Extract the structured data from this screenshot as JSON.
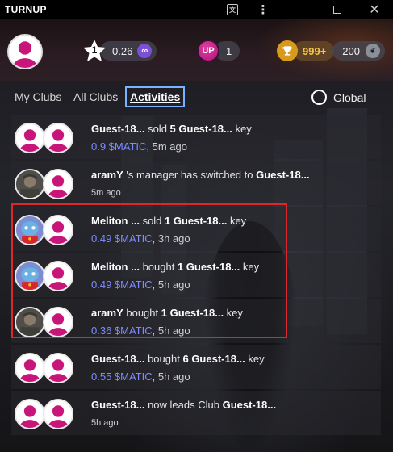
{
  "window": {
    "title": "TURNUP",
    "buttons": {
      "translate": "translate-icon",
      "menu": "more-vertical-icon",
      "minimize": "minimize-icon",
      "maximize": "maximize-icon",
      "close": "close-icon"
    }
  },
  "header": {
    "stars": {
      "badge": "1",
      "value": "0.26",
      "chain_icon": "polygon-icon"
    },
    "ups": {
      "badge": "UP",
      "value": "1"
    },
    "trophy": {
      "value": "999+"
    },
    "points": {
      "value": "200",
      "icon": "leaf-icon"
    }
  },
  "tabs": {
    "items": [
      "My Clubs",
      "All Clubs",
      "Activities"
    ],
    "active": "Activities",
    "global_label": "Global"
  },
  "activities": [
    {
      "actor": "Guest-18...",
      "verb": " sold ",
      "amount": "5",
      "subject": " Guest-18...",
      "suffix": " key",
      "price": "0.9 $MATIC",
      "time": ", 5m ago"
    },
    {
      "actor": "aramY",
      "verb": " 's manager has switched to ",
      "subject": "Guest-18...",
      "time": "5m ago"
    },
    {
      "actor": "Meliton ...",
      "verb": " sold ",
      "amount": "1",
      "subject": " Guest-18...",
      "suffix": " key",
      "price": "0.49 $MATIC",
      "time": ", 3h ago"
    },
    {
      "actor": "Meliton ...",
      "verb": " bought ",
      "amount": "1",
      "subject": " Guest-18...",
      "suffix": " key",
      "price": "0.49 $MATIC",
      "time": ", 5h ago"
    },
    {
      "actor": "aramY",
      "verb": " bought ",
      "amount": "1",
      "subject": " Guest-18...",
      "suffix": " key",
      "price": "0.36 $MATIC",
      "time": ", 5h ago"
    },
    {
      "actor": "Guest-18...",
      "verb": " bought ",
      "amount": "6",
      "subject": " Guest-18...",
      "suffix": " key",
      "price": "0.55 $MATIC",
      "time": ", 5h ago"
    },
    {
      "actor": "Guest-18...",
      "verb": " now leads Club ",
      "subject": "Guest-18...",
      "time": "5h ago"
    }
  ],
  "colors": {
    "accent_price": "#7e8cff",
    "highlight_border": "#e0262b",
    "active_tab_border": "#79b3ff",
    "avatar_magenta": "#c8157a"
  }
}
